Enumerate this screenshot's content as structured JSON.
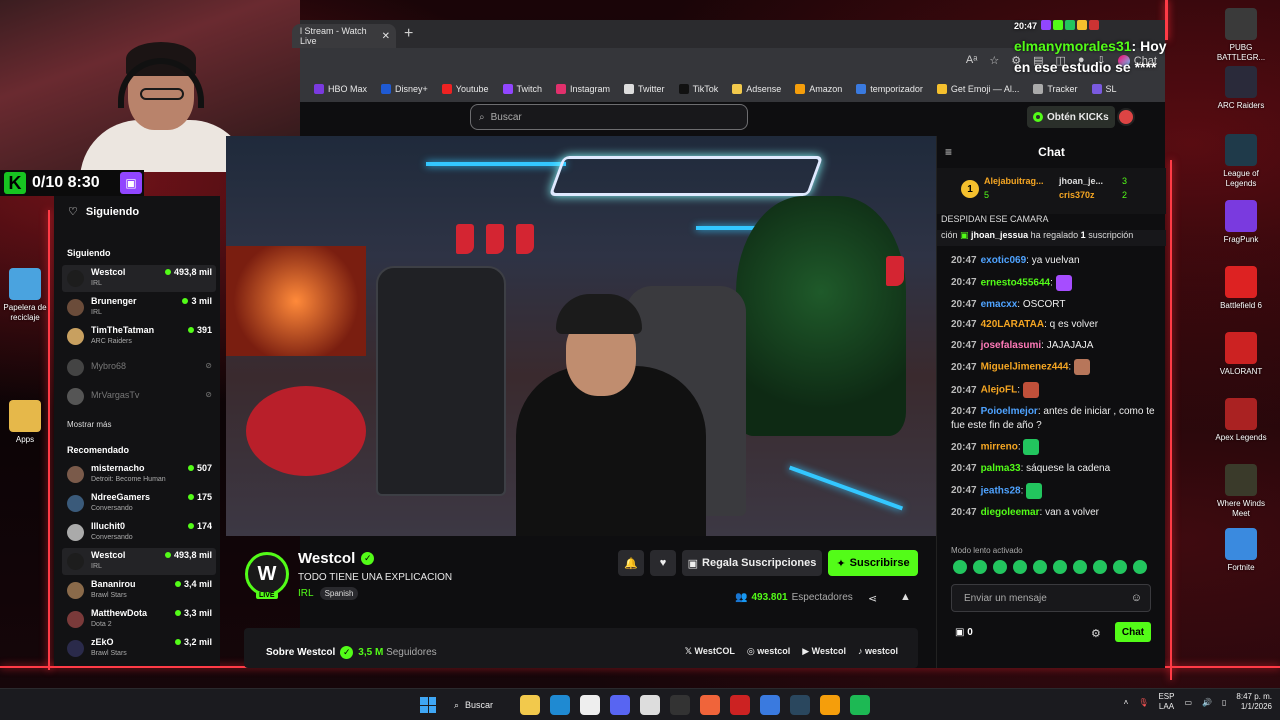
{
  "overlay": {
    "counter": "0/10 8:30",
    "chat_time": "20:47",
    "chat_user": "elmanymorales31",
    "chat_text": ": Hoy en ese estudio se ****"
  },
  "browser": {
    "tab_title": "l Stream - Watch Live",
    "chat_pill": "Chat",
    "bookmarks": [
      "HBO Max",
      "Disney+",
      "Youtube",
      "Twitch",
      "Instagram",
      "Twitter",
      "TikTok",
      "Adsense",
      "Amazon",
      "temporizador",
      "Get Emoji — Al...",
      "Tracker",
      "SL"
    ]
  },
  "site": {
    "search_placeholder": "Buscar",
    "kicks_label": "Obtén KICKs"
  },
  "sidebar": {
    "following_header": "Siguiendo",
    "section_following": "Siguiendo",
    "section_recommended": "Recomendado",
    "show_more": "Mostrar más",
    "following": [
      {
        "name": "Westcol",
        "category": "IRL",
        "viewers": "493,8 mil",
        "color": "#1d1d1d",
        "active": true
      },
      {
        "name": "Brunenger",
        "category": "IRL",
        "viewers": "3 mil",
        "color": "#6b4c3a"
      },
      {
        "name": "TimTheTatman",
        "category": "ARC Raiders",
        "viewers": "391",
        "color": "#c8a060"
      }
    ],
    "offline": [
      {
        "name": "Mybro68",
        "color": "#444"
      },
      {
        "name": "MrVargasTv",
        "color": "#555"
      }
    ],
    "recommended": [
      {
        "name": "misternacho",
        "category": "Detroit: Become Human",
        "viewers": "507",
        "color": "#7a5a4a"
      },
      {
        "name": "NdreeGamers",
        "category": "Conversando",
        "viewers": "175",
        "color": "#3a5a7a"
      },
      {
        "name": "Illuchit0",
        "category": "Conversando",
        "viewers": "174",
        "color": "#aaa"
      },
      {
        "name": "Westcol",
        "category": "IRL",
        "viewers": "493,8 mil",
        "color": "#1d1d1d",
        "active": true
      },
      {
        "name": "Bananirou",
        "category": "Brawl Stars",
        "viewers": "3,4 mil",
        "color": "#8a6a4a"
      },
      {
        "name": "MatthewDota",
        "category": "Dota 2",
        "viewers": "3,3 mil",
        "color": "#7a3a3a"
      },
      {
        "name": "zEkO",
        "category": "Brawl Stars",
        "viewers": "3,2 mil",
        "color": "#2a2a4a"
      }
    ]
  },
  "stream": {
    "streamer": "Westcol",
    "avatar_letter": "W",
    "live_label": "LIVE",
    "title": "TODO TIENE UNA EXPLICACION",
    "category": "IRL",
    "language": "Spanish",
    "gift_label": "Regala Suscripciones",
    "subscribe_label": "Suscribirse",
    "viewers": "493.801",
    "viewers_label": "Espectadores",
    "about_label": "Sobre Westcol",
    "followers": "3,5 M",
    "followers_label": "Seguidores",
    "socials": [
      "WestCOL",
      "westcol",
      "Westcol",
      "westcol"
    ]
  },
  "chat": {
    "header": "Chat",
    "gifters": {
      "rank": "1",
      "top_name": "Alejabuitrag...",
      "top_count": "5",
      "second_name": "jhoan_je...",
      "second_count": "3",
      "third_name": "cris370z",
      "third_count": "2"
    },
    "pinned": "DESPIDAN ESE CAMARA",
    "gift_user": "jhoan_jessua",
    "gift_text_a": "ción",
    "gift_text_b": "ha regalado",
    "gift_count": "1",
    "gift_text_c": "suscripción",
    "messages": [
      {
        "time": "20:47",
        "user": "exotic069",
        "color": "#4fa3ff",
        "text": "ya vuelvan"
      },
      {
        "time": "20:47",
        "user": "ernesto455644",
        "color": "#53fc18",
        "text": "",
        "emote": "#a64dff"
      },
      {
        "time": "20:47",
        "user": "emacxx",
        "color": "#4fa3ff",
        "text": "OSCORT"
      },
      {
        "time": "20:47",
        "user": "420LARATAA",
        "color": "#f5a623",
        "text": "q es volver"
      },
      {
        "time": "20:47",
        "user": "josefalasumi",
        "color": "#ff7ab8",
        "text": "JAJAJAJA"
      },
      {
        "time": "20:47",
        "user": "MiguelJimenez444",
        "color": "#f5a623",
        "text": "",
        "emote": "#b7765a"
      },
      {
        "time": "20:47",
        "user": "AlejoFL",
        "color": "#f5a623",
        "text": "",
        "emote": "#c0503a"
      },
      {
        "time": "20:47",
        "user": "Poioelmejor",
        "color": "#4fa3ff",
        "text": "antes de iniciar , como te fue este fin de año ?"
      },
      {
        "time": "20:47",
        "user": "mirreno",
        "color": "#f5a623",
        "text": "",
        "emote": "#22c55e"
      },
      {
        "time": "20:47",
        "user": "palma33",
        "color": "#53fc18",
        "text": "sáquese la cadena"
      },
      {
        "time": "20:47",
        "user": "jeaths28",
        "color": "#4fa3ff",
        "text": "",
        "emote": "#22c55e"
      },
      {
        "time": "20:47",
        "user": "diegoleemar",
        "color": "#53fc18",
        "text": "van a volver"
      }
    ],
    "slow_mode": "Modo lento activado",
    "input_placeholder": "Enviar un mensaje",
    "points": "0",
    "send_label": "Chat"
  },
  "desktop": {
    "icons_left": [
      {
        "label": "Papelera de reciclaje",
        "color": "#4aa3df"
      },
      {
        "label": "Apps",
        "color": "#e6b84a"
      }
    ],
    "icons_right": [
      {
        "label": "PUBG BATTLEGR...",
        "color": "#3a3a3a"
      },
      {
        "label": "ARC Raiders",
        "color": "#2a2a3a"
      },
      {
        "label": "League of Legends",
        "color": "#1f3a4a"
      },
      {
        "label": "FragPunk",
        "color": "#7a3adf"
      },
      {
        "label": "Battlefield 6",
        "color": "#d22"
      },
      {
        "label": "VALORANT",
        "color": "#c22"
      },
      {
        "label": "Apex Legends",
        "color": "#a22"
      },
      {
        "label": "Where Winds Meet",
        "color": "#3a3a2a"
      },
      {
        "label": "Fortnite",
        "color": "#3a8adf"
      }
    ]
  },
  "taskbar": {
    "search_label": "Buscar",
    "lang_1": "ESP",
    "lang_2": "LAA",
    "time": "8:47 p. m.",
    "date": "1/1/2026",
    "app_colors": [
      "#f2c94c",
      "#1f8ad2",
      "#eee",
      "#5865f2",
      "#ddd",
      "#333",
      "#f0643a",
      "#c22",
      "#3a7adf",
      "#2a475e",
      "#f59e0b",
      "#1db954"
    ]
  },
  "colors": {
    "kick_green": "#53fc18",
    "accent_red": "#ff3b46"
  }
}
